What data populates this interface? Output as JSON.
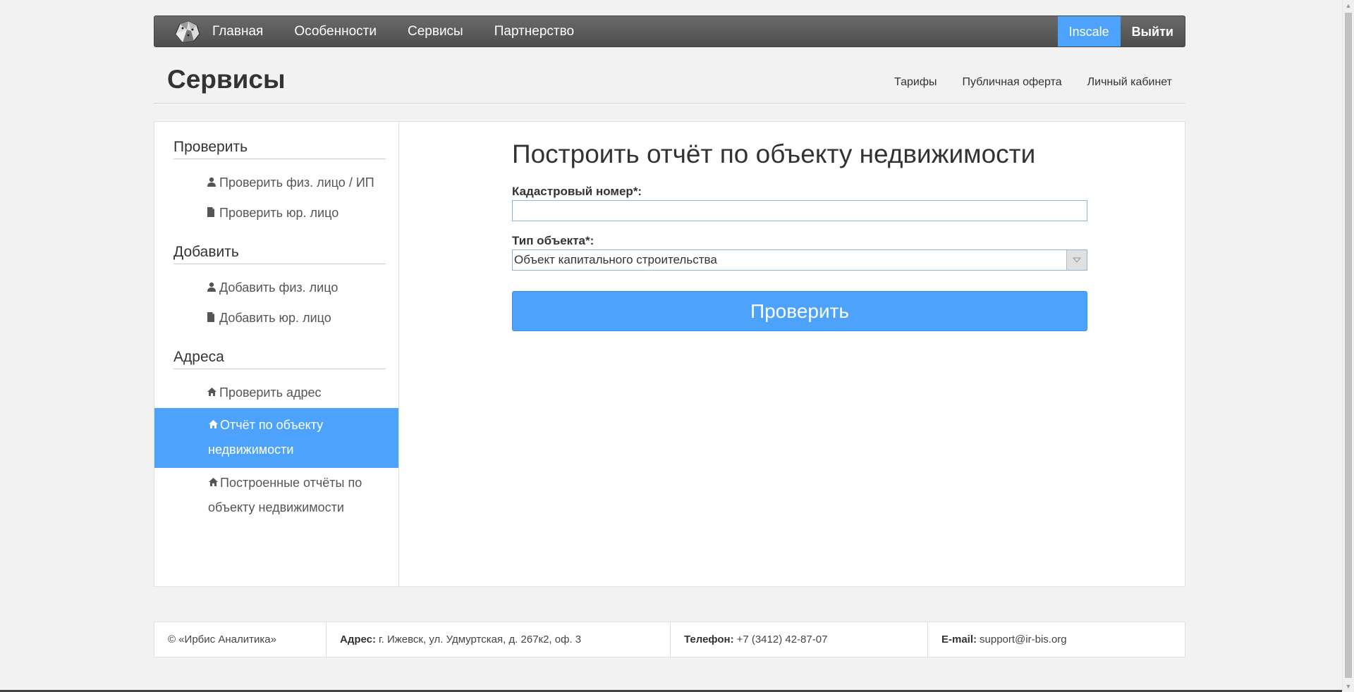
{
  "navbar": {
    "logo_icon": "snow-leopard-logo-icon",
    "links": [
      "Главная",
      "Особенности",
      "Сервисы",
      "Партнерство"
    ],
    "user": "Inscale",
    "logout": "Выйти"
  },
  "header": {
    "title": "Сервисы",
    "links": [
      "Тарифы",
      "Публичная оферта",
      "Личный кабинет"
    ]
  },
  "sidebar": {
    "sections": [
      {
        "heading": "Проверить",
        "items": [
          {
            "icon": "user-icon",
            "label": "Проверить физ. лицо / ИП"
          },
          {
            "icon": "document-icon",
            "label": "Проверить юр. лицо"
          }
        ]
      },
      {
        "heading": "Добавить",
        "items": [
          {
            "icon": "user-icon",
            "label": "Добавить физ. лицо"
          },
          {
            "icon": "document-icon",
            "label": "Добавить юр. лицо"
          }
        ]
      },
      {
        "heading": "Адреса",
        "items": [
          {
            "icon": "home-icon",
            "label": "Проверить адрес"
          },
          {
            "icon": "home-icon",
            "label": "Отчёт по объекту недвижимости",
            "active": true
          },
          {
            "icon": "home-icon",
            "label": "Построенные отчёты по объекту недвижимости"
          }
        ]
      }
    ]
  },
  "form": {
    "title": "Построить отчёт по объекту недвижимости",
    "cadastral_label": "Кадастровый номер*:",
    "cadastral_value": "",
    "type_label": "Тип объекта*:",
    "type_value": "Объект капитального строительства",
    "submit": "Проверить"
  },
  "footer": {
    "copyright": "© «Ирбис Аналитика»",
    "address_label": "Адрес:",
    "address": "г. Ижевск, ул. Удмуртская, д. 267к2, оф. 3",
    "phone_label": "Телефон:",
    "phone": "+7 (3412) 42-87-07",
    "email_label": "E-mail:",
    "email": "support@ir-bis.org"
  },
  "colors": {
    "accent": "#4da3fc",
    "navbar": "#5a5a5a",
    "background": "#f2f2f2"
  }
}
